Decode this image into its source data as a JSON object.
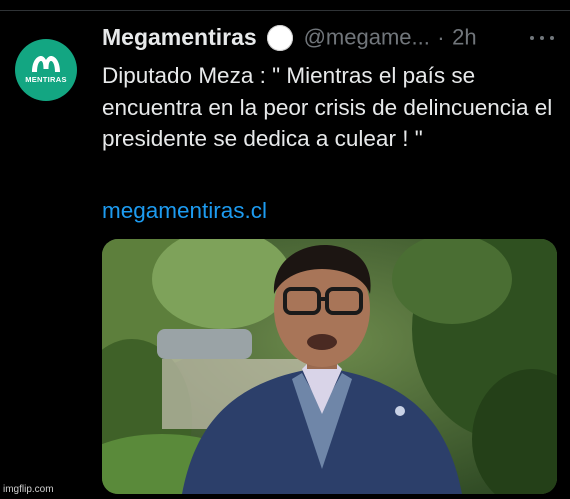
{
  "account": {
    "display_name": "Megamentiras",
    "handle": "@megame...",
    "separator": "·",
    "timestamp": "2h",
    "avatar_label": "MENTIRAS",
    "avatar_color": "#13a682"
  },
  "tweet": {
    "text": "Diputado Meza : \" Mientras el país se encuentra en la peor crisis de delincuencia el presidente se dedica a culear ! \"",
    "link": "megamentiras.cl"
  },
  "colors": {
    "link": "#1d9bf0",
    "secondary_text": "#71767b",
    "primary_text": "#e7e9ea"
  },
  "watermark": "imgflip.com"
}
